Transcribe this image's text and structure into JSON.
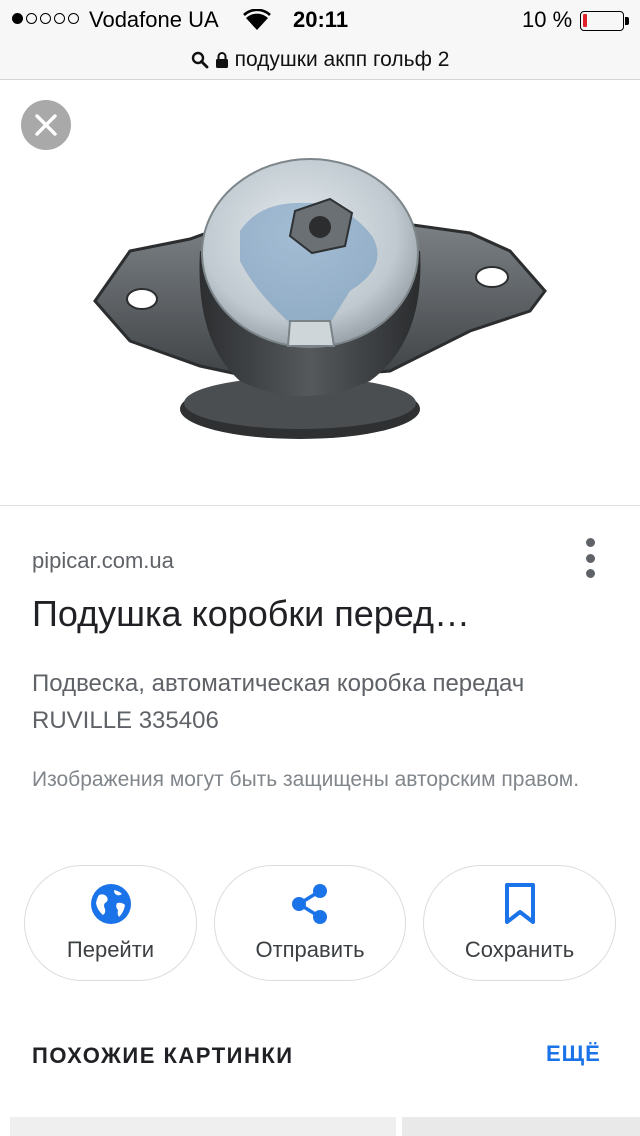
{
  "status_bar": {
    "carrier": "Vodafone UA",
    "signal_bars_filled": 1,
    "signal_bars_total": 5,
    "time": "20:11",
    "battery_percent": "10 %",
    "battery_level": 0.1,
    "battery_color": "#e0232b"
  },
  "url_bar": {
    "query": "подушки акпп гольф 2",
    "icons": [
      "search-icon",
      "lock-icon"
    ]
  },
  "viewer": {
    "close_icon": "close-icon",
    "image_alt": "product-photo"
  },
  "result": {
    "source": "pipicar.com.ua",
    "title": "Подушка коробки перед…",
    "description": "Подвеска, автоматическая коробка передач RUVILLE 335406",
    "copyright_notice": "Изображения могут быть защищены авторским правом."
  },
  "actions": [
    {
      "label": "Перейти",
      "icon": "globe-icon"
    },
    {
      "label": "Отправить",
      "icon": "share-icon"
    },
    {
      "label": "Сохранить",
      "icon": "bookmark-icon"
    }
  ],
  "similar": {
    "heading": "ПОХОЖИЕ КАРТИНКИ",
    "more_label": "ЕЩЁ"
  },
  "colors": {
    "accent": "#1a73e8",
    "close_button": "#a9a9a9"
  }
}
